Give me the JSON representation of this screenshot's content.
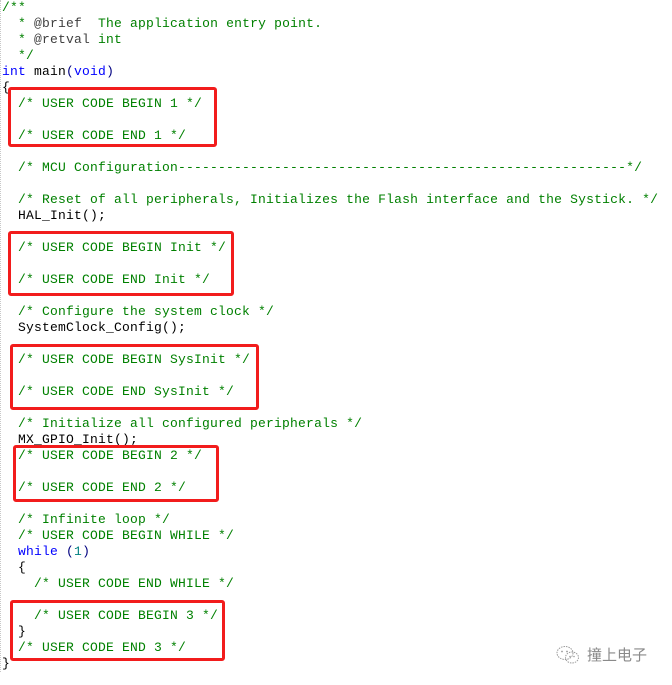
{
  "editor": {
    "lines": [
      {
        "indent": "",
        "tokens": [
          {
            "t": "/**",
            "k": "comment"
          }
        ]
      },
      {
        "indent": "  ",
        "tokens": [
          {
            "t": "* ",
            "k": "comment"
          },
          {
            "t": "@brief",
            "k": "doctag"
          },
          {
            "t": "  The application entry point.",
            "k": "comment"
          }
        ]
      },
      {
        "indent": "  ",
        "tokens": [
          {
            "t": "* ",
            "k": "comment"
          },
          {
            "t": "@retval",
            "k": "doctag"
          },
          {
            "t": " int",
            "k": "comment"
          }
        ]
      },
      {
        "indent": "  ",
        "tokens": [
          {
            "t": "*/",
            "k": "comment"
          }
        ]
      },
      {
        "indent": "",
        "tokens": [
          {
            "t": "int",
            "k": "kw"
          },
          {
            "t": " main",
            "k": "plain"
          },
          {
            "t": "(",
            "k": "punc"
          },
          {
            "t": "void",
            "k": "kw"
          },
          {
            "t": ")",
            "k": "punc"
          }
        ]
      },
      {
        "indent": "",
        "tokens": [
          {
            "t": "{",
            "k": "plain"
          }
        ]
      },
      {
        "indent": "  ",
        "tokens": [
          {
            "t": "/* USER CODE BEGIN 1 */",
            "k": "comment"
          }
        ]
      },
      {
        "indent": "",
        "tokens": []
      },
      {
        "indent": "  ",
        "tokens": [
          {
            "t": "/* USER CODE END 1 */",
            "k": "comment"
          }
        ]
      },
      {
        "indent": "",
        "tokens": []
      },
      {
        "indent": "  ",
        "tokens": [
          {
            "t": "/* MCU Configuration--------------------------------------------------------*/",
            "k": "comment"
          }
        ]
      },
      {
        "indent": "",
        "tokens": []
      },
      {
        "indent": "  ",
        "tokens": [
          {
            "t": "/* Reset of all peripherals, Initializes the Flash interface and the Systick. */",
            "k": "comment"
          }
        ]
      },
      {
        "indent": "  ",
        "tokens": [
          {
            "t": "HAL_Init",
            "k": "plain"
          },
          {
            "t": "();",
            "k": "plain"
          }
        ]
      },
      {
        "indent": "",
        "tokens": []
      },
      {
        "indent": "  ",
        "tokens": [
          {
            "t": "/* USER CODE BEGIN Init */",
            "k": "comment"
          }
        ]
      },
      {
        "indent": "",
        "tokens": []
      },
      {
        "indent": "  ",
        "tokens": [
          {
            "t": "/* USER CODE END Init */",
            "k": "comment"
          }
        ]
      },
      {
        "indent": "",
        "tokens": []
      },
      {
        "indent": "  ",
        "tokens": [
          {
            "t": "/* Configure the system clock */",
            "k": "comment"
          }
        ]
      },
      {
        "indent": "  ",
        "tokens": [
          {
            "t": "SystemClock_Config",
            "k": "plain"
          },
          {
            "t": "();",
            "k": "plain"
          }
        ]
      },
      {
        "indent": "",
        "tokens": []
      },
      {
        "indent": "  ",
        "tokens": [
          {
            "t": "/* USER CODE BEGIN SysInit */",
            "k": "comment"
          }
        ]
      },
      {
        "indent": "",
        "tokens": []
      },
      {
        "indent": "  ",
        "tokens": [
          {
            "t": "/* USER CODE END SysInit */",
            "k": "comment"
          }
        ]
      },
      {
        "indent": "",
        "tokens": []
      },
      {
        "indent": "  ",
        "tokens": [
          {
            "t": "/* Initialize all configured peripherals */",
            "k": "comment"
          }
        ]
      },
      {
        "indent": "  ",
        "tokens": [
          {
            "t": "MX_GPIO_Init",
            "k": "plain"
          },
          {
            "t": "();",
            "k": "plain"
          }
        ]
      },
      {
        "indent": "  ",
        "tokens": [
          {
            "t": "/* USER CODE BEGIN 2 */",
            "k": "comment"
          }
        ]
      },
      {
        "indent": "",
        "tokens": []
      },
      {
        "indent": "  ",
        "tokens": [
          {
            "t": "/* USER CODE END 2 */",
            "k": "comment"
          }
        ]
      },
      {
        "indent": "",
        "tokens": []
      },
      {
        "indent": "  ",
        "tokens": [
          {
            "t": "/* Infinite loop */",
            "k": "comment"
          }
        ]
      },
      {
        "indent": "  ",
        "tokens": [
          {
            "t": "/* USER CODE BEGIN WHILE */",
            "k": "comment"
          }
        ]
      },
      {
        "indent": "  ",
        "tokens": [
          {
            "t": "while",
            "k": "kw"
          },
          {
            "t": " (",
            "k": "punc"
          },
          {
            "t": "1",
            "k": "num"
          },
          {
            "t": ")",
            "k": "punc"
          }
        ]
      },
      {
        "indent": "  ",
        "tokens": [
          {
            "t": "{",
            "k": "plain"
          }
        ]
      },
      {
        "indent": "    ",
        "tokens": [
          {
            "t": "/* USER CODE END WHILE */",
            "k": "comment"
          }
        ]
      },
      {
        "indent": "",
        "tokens": []
      },
      {
        "indent": "    ",
        "tokens": [
          {
            "t": "/* USER CODE BEGIN 3 */",
            "k": "comment"
          }
        ]
      },
      {
        "indent": "  ",
        "tokens": [
          {
            "t": "}",
            "k": "plain"
          }
        ]
      },
      {
        "indent": "  ",
        "tokens": [
          {
            "t": "/* USER CODE END 3 */",
            "k": "comment"
          }
        ]
      },
      {
        "indent": "",
        "tokens": [
          {
            "t": "}",
            "k": "plain"
          }
        ]
      }
    ],
    "highlight_boxes": [
      {
        "label": "USER CODE 1",
        "color": "#f21c1c"
      },
      {
        "label": "USER CODE Init",
        "color": "#f21c1c"
      },
      {
        "label": "USER CODE SysInit",
        "color": "#f21c1c"
      },
      {
        "label": "USER CODE 2",
        "color": "#f21c1c"
      },
      {
        "label": "USER CODE 3",
        "color": "#f21c1c"
      }
    ],
    "colors": {
      "comment": "#008000",
      "keyword": "#0000ff",
      "number": "#008080",
      "highlight": "#f21c1c"
    }
  },
  "watermark": {
    "icon": "wechat-chat-icon",
    "text": "撞上电子"
  }
}
